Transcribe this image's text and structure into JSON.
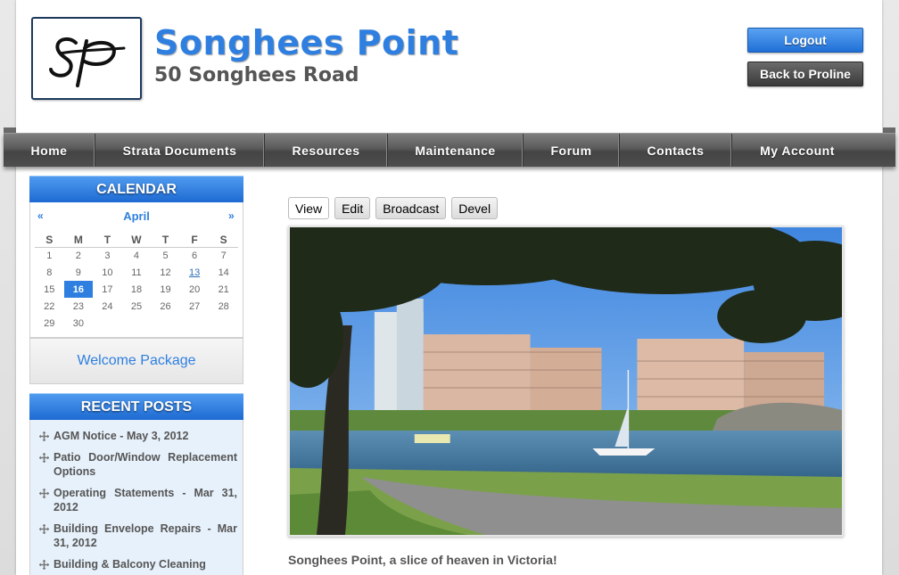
{
  "header": {
    "logo_text": "SP",
    "site_name": "Songhees Point",
    "site_slogan": "50 Songhees Road",
    "logout_label": "Logout",
    "back_label": "Back to Proline"
  },
  "nav": {
    "items": [
      {
        "label": "Home"
      },
      {
        "label": "Strata Documents"
      },
      {
        "label": "Resources"
      },
      {
        "label": "Maintenance"
      },
      {
        "label": "Forum"
      },
      {
        "label": "Contacts"
      },
      {
        "label": "My Account"
      }
    ]
  },
  "calendar": {
    "title": "CALENDAR",
    "prev": "«",
    "month": "April",
    "next": "»",
    "weekdays": [
      "S",
      "M",
      "T",
      "W",
      "T",
      "F",
      "S"
    ],
    "weeks": [
      [
        "1",
        "2",
        "3",
        "4",
        "5",
        "6",
        "7"
      ],
      [
        "8",
        "9",
        "10",
        "11",
        "12",
        "13",
        "14"
      ],
      [
        "15",
        "16",
        "17",
        "18",
        "19",
        "20",
        "21"
      ],
      [
        "22",
        "23",
        "24",
        "25",
        "26",
        "27",
        "28"
      ],
      [
        "29",
        "30",
        "",
        "",
        "",
        "",
        ""
      ]
    ],
    "today": "16",
    "linked": [
      "13"
    ]
  },
  "welcome_link": "Welcome Package",
  "recent_posts": {
    "title": "RECENT POSTS",
    "items": [
      {
        "label": "AGM Notice - May 3, 2012"
      },
      {
        "label": "Patio Door/Window Replacement Options"
      },
      {
        "label": "Operating Statements - Mar 31, 2012"
      },
      {
        "label": "Building Envelope Repairs - Mar 31, 2012"
      },
      {
        "label": "Building & Balcony Cleaning"
      }
    ]
  },
  "tabs": [
    {
      "label": "View"
    },
    {
      "label": "Edit"
    },
    {
      "label": "Broadcast"
    },
    {
      "label": "Devel"
    }
  ],
  "caption": "Songhees Point, a slice of heaven in Victoria!",
  "colors": {
    "accent": "#2e7fe0",
    "nav": "#555555",
    "brand_blue": "#1f6fd6"
  }
}
